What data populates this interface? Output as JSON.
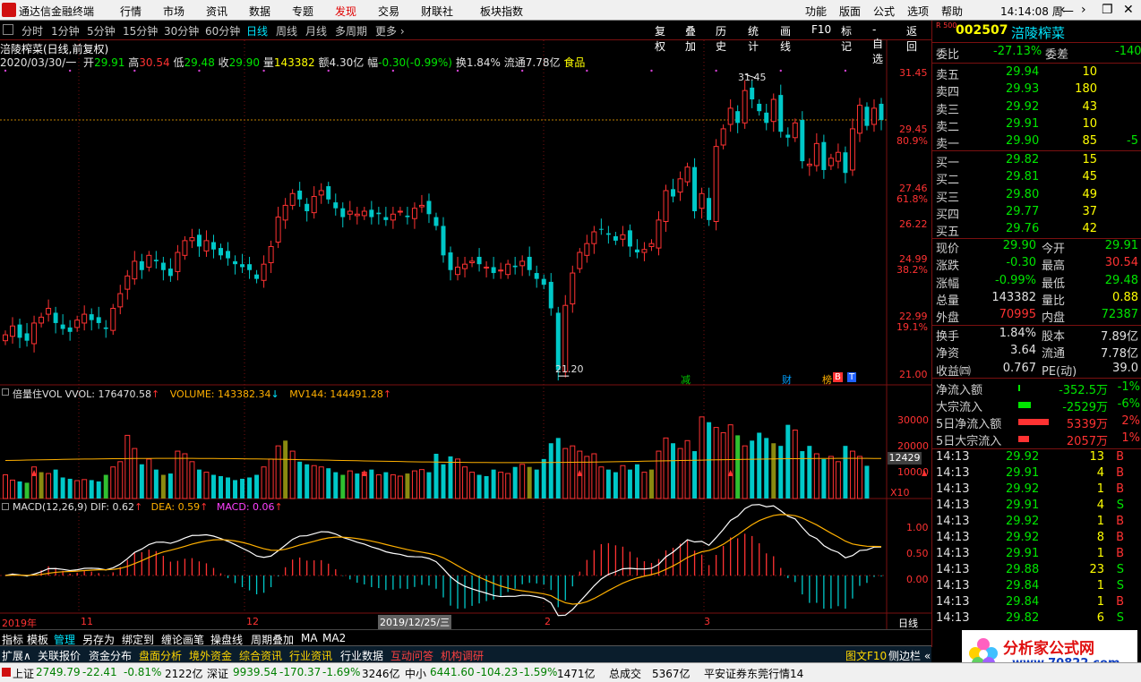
{
  "menubar": {
    "app_title": "通达信金融终端",
    "items": [
      "行情",
      "市场",
      "资讯",
      "数据",
      "专题",
      "发现",
      "交易",
      "财联社",
      "板块指数"
    ],
    "active": "发现",
    "right_items": [
      "功能",
      "版面",
      "公式",
      "选项",
      "帮助"
    ],
    "clock": "14:14:08 周一",
    "window_buttons": [
      "‹",
      "›",
      "❐",
      "✕"
    ]
  },
  "periodbar": {
    "items": [
      "分时",
      "1分钟",
      "5分钟",
      "15分钟",
      "30分钟",
      "60分钟",
      "日线",
      "周线",
      "月线",
      "多周期",
      "更多 ›"
    ],
    "selected": "日线"
  },
  "toolbar": {
    "items": [
      "复权",
      "叠加",
      "历史",
      "统计",
      "画线",
      "F10",
      "标记",
      "-自选",
      "返回"
    ]
  },
  "chart_header": {
    "stock_title": "涪陵榨菜(日线,前复权)",
    "date": "2020/03/30/一",
    "open_label": "开",
    "open": "29.91",
    "high_label": "高",
    "high": "30.54",
    "low_label": "低",
    "low": "29.48",
    "close_label": "收",
    "close": "29.90",
    "vol_label": "量",
    "vol": "143382",
    "amt_label": "额",
    "amt": "4.30亿",
    "chg_label": "幅",
    "chg": "-0.30(-0.99%)",
    "turnover_label": "换",
    "turnover": "1.84%",
    "float_label": "流通",
    "float": "7.78亿",
    "sector": "食品"
  },
  "price_axis": {
    "ticks": [
      "31.45",
      "29.45",
      "27.46",
      "26.22",
      "24.99",
      "22.99",
      "21.00"
    ],
    "pct_ticks": [
      "80.9%",
      "61.8%",
      "38.2%",
      "19.1%"
    ],
    "ref_line": 29.9
  },
  "annotations": {
    "high_label": "31.45",
    "low_label": "21.20",
    "badges": [
      {
        "text": "减",
        "color": "#00c800"
      },
      {
        "text": "财",
        "color": "#00a0ff"
      },
      {
        "text": "榜",
        "color": "#ffb000"
      },
      {
        "text": "B",
        "color": "#ff3232"
      },
      {
        "text": "T",
        "color": "#2060ff"
      }
    ]
  },
  "volume_panel": {
    "title": "倍量住VOL",
    "vvol_label": "VVOL:",
    "vvol": "176470.58",
    "volume_label": "VOLUME:",
    "volume": "143382.34",
    "mv_label": "MV144:",
    "mv": "144491.28",
    "ticks": [
      "30000",
      "20000",
      "10000"
    ],
    "current_tag": "12429",
    "unit": "X10"
  },
  "macd_panel": {
    "title": "MACD(12,26,9)",
    "dif_label": "DIF:",
    "dif": "0.62",
    "dea_label": "DEA:",
    "dea": "0.59",
    "macd_label": "MACD:",
    "macd": "0.06",
    "ticks": [
      "1.00",
      "0.50",
      "0.00"
    ]
  },
  "time_axis": {
    "labels": [
      "2019年",
      "11",
      "12",
      "2019/12/25/三",
      "2",
      "3"
    ],
    "period": "日线"
  },
  "bottom_tabs": [
    "指标",
    "模板",
    "管理",
    "另存为",
    "绑定到",
    "缠论画笔",
    "操盘线",
    "周期叠加",
    "MA",
    "MA2"
  ],
  "func_tabs": [
    "扩展∧",
    "关联报价",
    "资金分布",
    "盘面分析",
    "境外资金",
    "综合资讯",
    "行业资讯",
    "行业数据",
    "互动问答",
    "机构调研"
  ],
  "func_right": [
    "图文F10",
    "侧边栏 «"
  ],
  "quote": {
    "code": "002507",
    "name": "涪陵榨菜",
    "tag": "R 500",
    "weibi_label": "委比",
    "weibi": "-27.13%",
    "weicha_label": "委差",
    "weicha": "-140",
    "asks": [
      {
        "label": "卖五",
        "price": "29.94",
        "vol": "10"
      },
      {
        "label": "卖四",
        "price": "29.93",
        "vol": "180"
      },
      {
        "label": "卖三",
        "price": "29.92",
        "vol": "43"
      },
      {
        "label": "卖二",
        "price": "29.91",
        "vol": "10"
      },
      {
        "label": "卖一",
        "price": "29.90",
        "vol": "85",
        "extra": "-5"
      }
    ],
    "bids": [
      {
        "label": "买一",
        "price": "29.82",
        "vol": "15"
      },
      {
        "label": "买二",
        "price": "29.81",
        "vol": "45"
      },
      {
        "label": "买三",
        "price": "29.80",
        "vol": "49"
      },
      {
        "label": "买四",
        "price": "29.77",
        "vol": "37"
      },
      {
        "label": "买五",
        "price": "29.76",
        "vol": "42"
      }
    ],
    "stats": [
      {
        "l1": "现价",
        "v1": "29.90",
        "c1": "dn",
        "l2": "今开",
        "v2": "29.91",
        "c2": "dn"
      },
      {
        "l1": "涨跌",
        "v1": "-0.30",
        "c1": "dn",
        "l2": "最高",
        "v2": "30.54",
        "c2": "up"
      },
      {
        "l1": "涨幅",
        "v1": "-0.99%",
        "c1": "dn",
        "l2": "最低",
        "v2": "29.48",
        "c2": "dn"
      },
      {
        "l1": "总量",
        "v1": "143382",
        "c1": "wh",
        "l2": "量比",
        "v2": "0.88",
        "c2": "yl"
      },
      {
        "l1": "外盘",
        "v1": "70995",
        "c1": "up",
        "l2": "内盘",
        "v2": "72387",
        "c2": "dn"
      }
    ],
    "stats2": [
      {
        "l1": "换手",
        "v1": "1.84%",
        "l2": "股本",
        "v2": "7.89亿"
      },
      {
        "l1": "净资",
        "v1": "3.64",
        "l2": "流通",
        "v2": "7.78亿"
      },
      {
        "l1": "收益㈣",
        "v1": "0.767",
        "l2": "PE(动)",
        "v2": "39.0"
      }
    ],
    "flows": [
      {
        "label": "净流入额",
        "value": "-352.5万",
        "pct": "-1%",
        "bar": "#00e600",
        "barw": 2
      },
      {
        "label": "大宗流入",
        "value": "-2529万",
        "pct": "-6%",
        "bar": "#00e600",
        "barw": 14
      },
      {
        "label": "5日净流入额",
        "value": "5339万",
        "pct": "2%",
        "bar": "#ff3232",
        "barw": 34
      },
      {
        "label": "5日大宗流入",
        "value": "2057万",
        "pct": "1%",
        "bar": "#ff3232",
        "barw": 12
      }
    ],
    "ticks": [
      {
        "t": "14:13",
        "p": "29.92",
        "v": "13",
        "bs": "B"
      },
      {
        "t": "14:13",
        "p": "29.91",
        "v": "4",
        "bs": "B"
      },
      {
        "t": "14:13",
        "p": "29.92",
        "v": "1",
        "bs": "B"
      },
      {
        "t": "14:13",
        "p": "29.91",
        "v": "4",
        "bs": "S"
      },
      {
        "t": "14:13",
        "p": "29.92",
        "v": "1",
        "bs": "B"
      },
      {
        "t": "14:13",
        "p": "29.92",
        "v": "8",
        "bs": "B"
      },
      {
        "t": "14:13",
        "p": "29.91",
        "v": "1",
        "bs": "B"
      },
      {
        "t": "14:13",
        "p": "29.88",
        "v": "23",
        "bs": "S"
      },
      {
        "t": "14:13",
        "p": "29.84",
        "v": "1",
        "bs": "S"
      },
      {
        "t": "14:13",
        "p": "29.84",
        "v": "1",
        "bs": "B"
      },
      {
        "t": "14:13",
        "p": "29.82",
        "v": "6",
        "bs": "S"
      }
    ]
  },
  "statusbar": {
    "sh_label": "上证",
    "sh": "2749.79",
    "sh_chg": "-22.41",
    "sh_pct": "-0.81%",
    "sh_amt": "2122亿",
    "sz_label": "深证",
    "sz": "9939.54",
    "sz_chg": "-170.37",
    "sz_pct": "-1.69%",
    "sz_amt": "3246亿",
    "zx_label": "中小",
    "zx": "6441.60",
    "zx_chg": "-104.23",
    "zx_pct": "-1.59%",
    "zx_amt": "1471亿",
    "total_label": "总成交",
    "total": "5367亿",
    "broker": "平安证券东莞行情14"
  },
  "ad": {
    "title": "分析家公式网",
    "url": "www.70822.com"
  },
  "colors": {
    "up": "#ff3232",
    "down": "#00c8c8",
    "dif": "#ffffff",
    "dea": "#ffb000",
    "grid": "#7a1010"
  },
  "chart_data": {
    "type": "candlestick",
    "closes": [
      22.6,
      22.9,
      22.5,
      22.4,
      23.0,
      23.2,
      23.5,
      23.0,
      22.8,
      22.7,
      23.1,
      23.3,
      23.1,
      23.0,
      22.8,
      23.5,
      24.0,
      24.6,
      25.1,
      24.8,
      25.3,
      25.1,
      24.8,
      24.6,
      25.4,
      25.8,
      25.9,
      25.6,
      25.8,
      25.5,
      25.3,
      25.2,
      25.0,
      24.9,
      24.8,
      24.5,
      25.0,
      25.6,
      26.6,
      27.0,
      27.4,
      27.2,
      26.8,
      27.3,
      27.5,
      27.2,
      26.9,
      26.6,
      26.8,
      26.7,
      26.8,
      26.6,
      26.7,
      26.5,
      26.7,
      26.8,
      26.6,
      26.9,
      27.0,
      26.7,
      26.3,
      25.3,
      24.8,
      24.9,
      25.0,
      25.1,
      25.0,
      24.9,
      24.7,
      24.8,
      25.0,
      24.9,
      25.1,
      24.8,
      24.5,
      24.3,
      23.5,
      21.4,
      23.6,
      24.7,
      25.4,
      25.7,
      26.1,
      26.2,
      26.0,
      25.8,
      26.0,
      25.6,
      25.4,
      25.5,
      25.7,
      26.5,
      27.5,
      27.3,
      27.9,
      28.3,
      26.8,
      27.4,
      26.5,
      29.0,
      29.6,
      30.3,
      29.8,
      30.9,
      30.6,
      30.2,
      29.8,
      30.6,
      29.5,
      29.3,
      29.8,
      28.5,
      28.4,
      29.1,
      28.2,
      28.6,
      28.8,
      28.1,
      29.6,
      30.4,
      29.7,
      30.3,
      29.9
    ],
    "volumes": [
      9000,
      7000,
      6500,
      6000,
      12000,
      10000,
      9500,
      11000,
      8000,
      7500,
      6800,
      7200,
      7000,
      6500,
      9000,
      12000,
      14000,
      24000,
      19000,
      13000,
      15000,
      11000,
      9000,
      9500,
      18000,
      17000,
      14000,
      11000,
      10000,
      9000,
      8500,
      8000,
      7000,
      7500,
      8000,
      9000,
      12000,
      15000,
      20000,
      22000,
      18000,
      14000,
      13000,
      12500,
      12000,
      11500,
      10000,
      9000,
      10500,
      9500,
      10000,
      11000,
      9000,
      10000,
      9000,
      8500,
      9500,
      10500,
      11000,
      10000,
      17000,
      13000,
      16000,
      15000,
      12000,
      10000,
      9000,
      8500,
      11000,
      10000,
      9500,
      12000,
      13000,
      12000,
      11000,
      15000,
      21000,
      23000,
      19000,
      20000,
      18000,
      16000,
      17000,
      12000,
      11000,
      10000,
      12500,
      11000,
      13000,
      10000,
      11000,
      18000,
      23000,
      21000,
      19000,
      22000,
      18000,
      31000,
      29000,
      27000,
      25000,
      28000,
      24000,
      20000,
      22000,
      25000,
      23000,
      21000,
      20000,
      28000,
      26000,
      18000,
      20000,
      17000,
      15000,
      16000,
      14000,
      20000,
      18000,
      16000,
      12429
    ]
  }
}
